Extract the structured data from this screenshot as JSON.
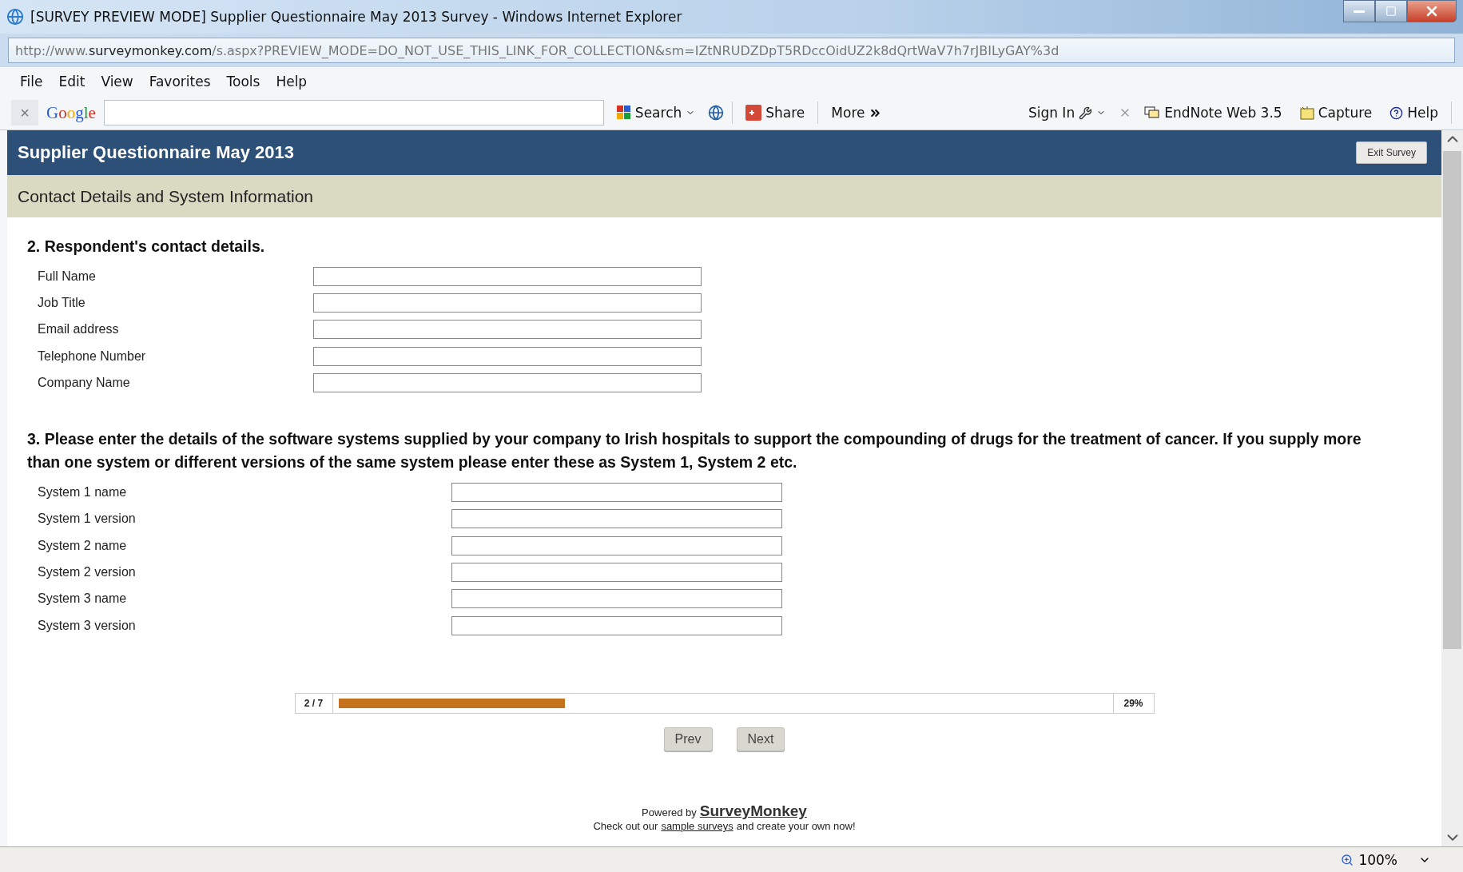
{
  "window": {
    "title": "[SURVEY PREVIEW MODE] Supplier Questionnaire May 2013 Survey - Windows Internet Explorer"
  },
  "address_bar": {
    "prefix": "http://www.",
    "domain": "surveymonkey.com",
    "path": "/s.aspx?PREVIEW_MODE=DO_NOT_USE_THIS_LINK_FOR_COLLECTION&sm=IZtNRUDZDpT5RDccOidUZ2k8dQrtWaV7h7rJBILyGAY%3d"
  },
  "menu": [
    "File",
    "Edit",
    "View",
    "Favorites",
    "Tools",
    "Help"
  ],
  "toolbar": {
    "close": "×",
    "logo": "Google",
    "left": [
      {
        "label": "Search",
        "kind": "search"
      },
      {
        "label": "Share",
        "kind": "share"
      },
      {
        "label": "More",
        "kind": "more"
      }
    ],
    "right": [
      {
        "label": "Sign In",
        "kind": "signin"
      },
      {
        "label": "EndNote Web 3.5",
        "kind": "endnote"
      },
      {
        "label": "Capture",
        "kind": "capture"
      },
      {
        "label": "Help",
        "kind": "help"
      }
    ]
  },
  "survey": {
    "title": "Supplier Questionnaire May 2013",
    "exit_button": "Exit Survey",
    "section_title": "Contact Details and System Information",
    "questions": [
      {
        "title": "2. Respondent's contact details.",
        "fields": [
          "Full Name",
          "Job Title",
          "Email address",
          "Telephone Number",
          "Company Name"
        ]
      },
      {
        "title": "3. Please enter the details of the software systems supplied by your company to Irish hospitals to support the compounding of drugs for the treatment of cancer. If you supply more than one system or different versions of the same system please enter these as System 1, System 2 etc.",
        "fields": [
          "System 1 name",
          "System 1 version",
          "System 2 name",
          "System 2 version",
          "System 3 name",
          "System 3 version"
        ]
      }
    ],
    "progress": {
      "page": "2 / 7",
      "percent": "29%"
    },
    "buttons": [
      "Prev",
      "Next"
    ],
    "footer": {
      "powered_by": "Powered by",
      "brand": "SurveyMonkey",
      "line_start": "Check out our",
      "link": "sample surveys",
      "line_end": "and create your own now!"
    }
  },
  "status_bar": {
    "zoom": "100%"
  }
}
